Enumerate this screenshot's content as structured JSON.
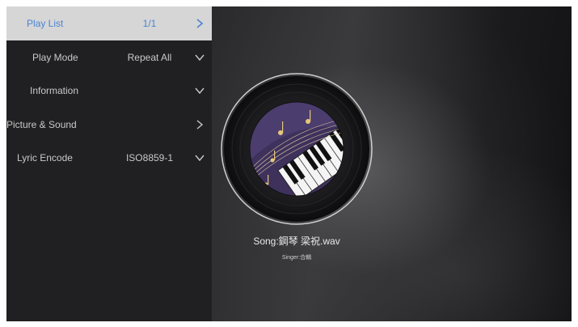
{
  "menu": {
    "items": [
      {
        "label": "Play List",
        "value": "1/1",
        "arrow": "chevron-right-icon",
        "selected": true
      },
      {
        "label": "Play Mode",
        "value": "Repeat All",
        "arrow": "chevron-down-icon",
        "selected": false
      },
      {
        "label": "Information",
        "value": "",
        "arrow": "chevron-down-icon",
        "selected": false
      },
      {
        "label": "Picture & Sound",
        "value": "",
        "arrow": "chevron-right-icon",
        "selected": false
      },
      {
        "label": "Lyric Encode",
        "value": "ISO8859-1",
        "arrow": "chevron-down-icon",
        "selected": false
      }
    ]
  },
  "now_playing": {
    "song": "Song:鋼琴 梁祝.wav",
    "singer": "Singer:合輯",
    "artwork": "vinyl-record-piano-artwork"
  },
  "colors": {
    "selected_background": "#d6d6d6",
    "selected_text": "#4a84d4",
    "menu_background": "#202022",
    "menu_text": "#c8c8c8"
  }
}
